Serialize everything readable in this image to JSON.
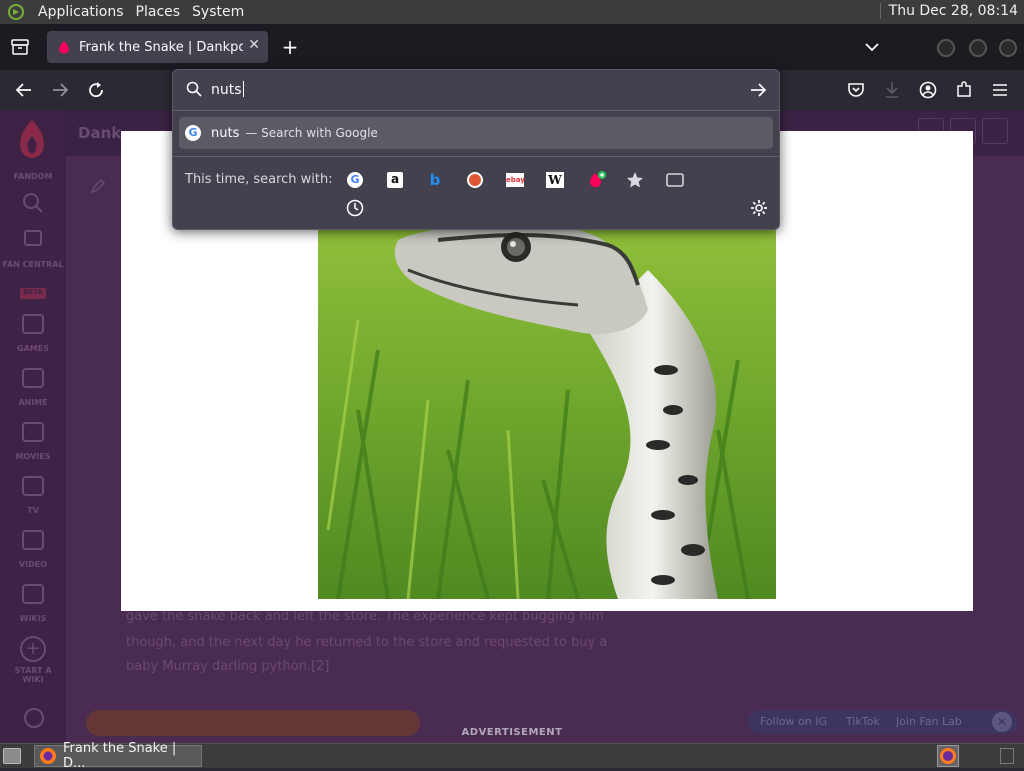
{
  "system_panel": {
    "menus": [
      "Applications",
      "Places",
      "System"
    ],
    "clock": "Thu Dec 28, 08:14"
  },
  "tab": {
    "title": "Frank the Snake | Dankpods",
    "close_icon": "close-icon"
  },
  "url_dropdown": {
    "query": "nuts",
    "suggestion_query": "nuts",
    "suggestion_action": "— Search with Google",
    "oneoff_label": "This time, search with:",
    "engines": [
      {
        "name": "Google",
        "glyph": "G",
        "color": "#4285f4"
      },
      {
        "name": "Amazon",
        "glyph": "a",
        "color": "#ffffff"
      },
      {
        "name": "Bing",
        "glyph": "b",
        "color": "#1f8df2"
      },
      {
        "name": "DuckDuckGo",
        "glyph": "●",
        "color": "#de5833"
      },
      {
        "name": "eBay",
        "glyph": "ebay",
        "color": "#e53238"
      },
      {
        "name": "Wikipedia",
        "glyph": "W",
        "color": "#ffffff"
      },
      {
        "name": "Fandom",
        "glyph": "♥",
        "color": "#fa005a"
      }
    ]
  },
  "page": {
    "site_header": "Dank",
    "sidebar": [
      "FANDOM",
      "FAN CENTRAL",
      "BETA",
      "GAMES",
      "ANIME",
      "MOVIES",
      "TV",
      "VIDEO",
      "WIKIS",
      "START A WIKI"
    ],
    "body_lines": [
      "gave the snake back and left the store. The experience kept bugging him",
      "though, and the next day he returned to the store and requested to buy a",
      "baby Murray darling python.[2]"
    ],
    "follow_bar": [
      "Follow on IG",
      "TikTok",
      "Join Fan Lab"
    ]
  },
  "ad_label": "ADVERTISEMENT",
  "taskbar": {
    "item": "Frank the Snake | D..."
  }
}
